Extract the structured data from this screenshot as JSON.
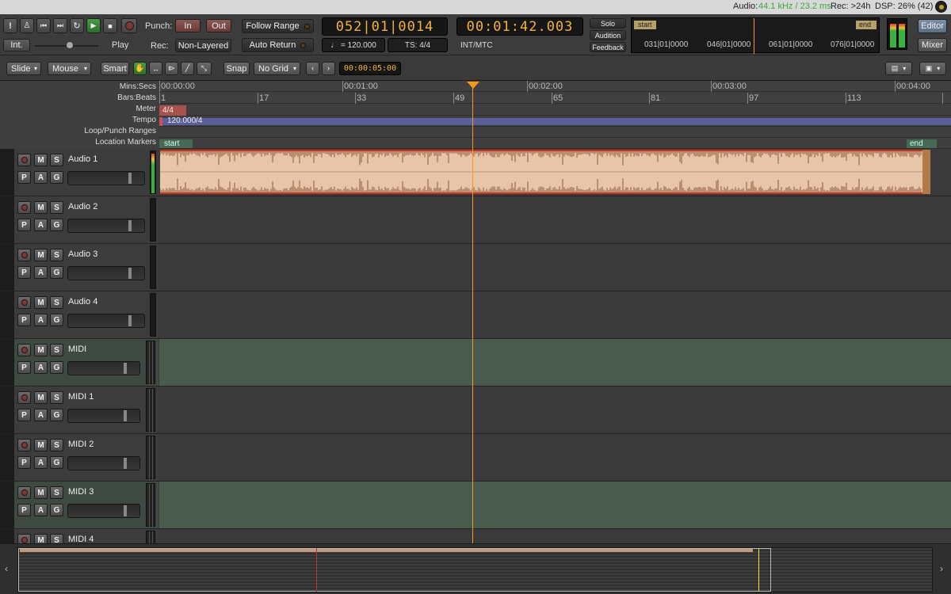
{
  "status": {
    "audio_label": "Audio:",
    "audio_value": "44.1 kHz / 23.2 ms",
    "rec": "Rec: >24h",
    "dsp": "DSP: 26% (42)"
  },
  "transport": {
    "int_label": "Int.",
    "play_label": "Play",
    "punch_label": "Punch:",
    "punch_in": "In",
    "punch_out": "Out",
    "rec_label": "Rec:",
    "rec_mode": "Non-Layered",
    "follow_range": "Follow Range",
    "auto_return": "Auto Return",
    "bbt_clock": "052|01|0014",
    "time_clock": "00:01:42.003",
    "tempo": "♩ = 120.000",
    "ts": "TS: 4/4",
    "sync": "INT/MTC",
    "solo": "Solo",
    "audition": "Audition",
    "feedback": "Feedback",
    "editor": "Editor",
    "mixer": "Mixer"
  },
  "mini_timeline": {
    "start": "start",
    "end": "end",
    "ticks": [
      "031|01|0000",
      "046|01|0000",
      "061|01|0000",
      "076|01|0000"
    ]
  },
  "edit_toolbar": {
    "edit_mode": "Slide",
    "ripple": "Mouse",
    "smart": "Smart",
    "snap": "Snap",
    "grid": "No Grid",
    "nudge_clock": "00:00:05:00"
  },
  "rulers": {
    "labels": [
      "Mins:Secs",
      "Bars:Beats",
      "Meter",
      "Tempo",
      "Loop/Punch Ranges",
      "Location Markers"
    ],
    "mins_secs": [
      "00:00:00",
      "00:01:00",
      "00:02:00",
      "00:03:00",
      "00:04:00"
    ],
    "bars": [
      "1",
      "17",
      "33",
      "49",
      "65",
      "81",
      "97",
      "113"
    ],
    "meter": "4/4",
    "tempo": "120.000/4",
    "marker_start": "start",
    "marker_end": "end"
  },
  "tracks": [
    {
      "name": "Audio 1",
      "type": "audio"
    },
    {
      "name": "Audio 2",
      "type": "audio"
    },
    {
      "name": "Audio 3",
      "type": "audio"
    },
    {
      "name": "Audio 4",
      "type": "audio"
    },
    {
      "name": "MIDI",
      "type": "midi"
    },
    {
      "name": "MIDI 1",
      "type": "midi"
    },
    {
      "name": "MIDI 2",
      "type": "midi"
    },
    {
      "name": "MIDI 3",
      "type": "midi"
    },
    {
      "name": "MIDI 4",
      "type": "midi"
    }
  ],
  "track_buttons": {
    "m": "M",
    "s": "S",
    "p": "P",
    "a": "A",
    "g": "G"
  },
  "colors": {
    "accent": "#f29a1d",
    "region": "#e8c4a8",
    "midi_lane": "#4b5a4e",
    "clock_text": "#f2b33d"
  }
}
